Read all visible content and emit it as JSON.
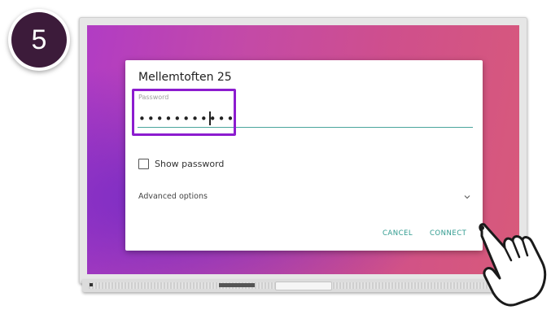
{
  "top_caption": "",
  "step_number": "5",
  "dialog": {
    "title": "Mellemtoften 25",
    "password_label": "Password",
    "password_value": "•••••••••••",
    "show_password_label": "Show password",
    "show_password_checked": false,
    "advanced_options_label": "Advanced options",
    "cancel_label": "CANCEL",
    "connect_label": "CONNECT"
  },
  "colors": {
    "accent": "#2e9a8e",
    "highlight": "#8c1ccf",
    "badge": "#3c1b3a"
  },
  "icons": {
    "advanced_toggle": "chevron-down-icon",
    "pointer": "hand-pointer-icon",
    "checkbox": "checkbox-unchecked-icon"
  }
}
